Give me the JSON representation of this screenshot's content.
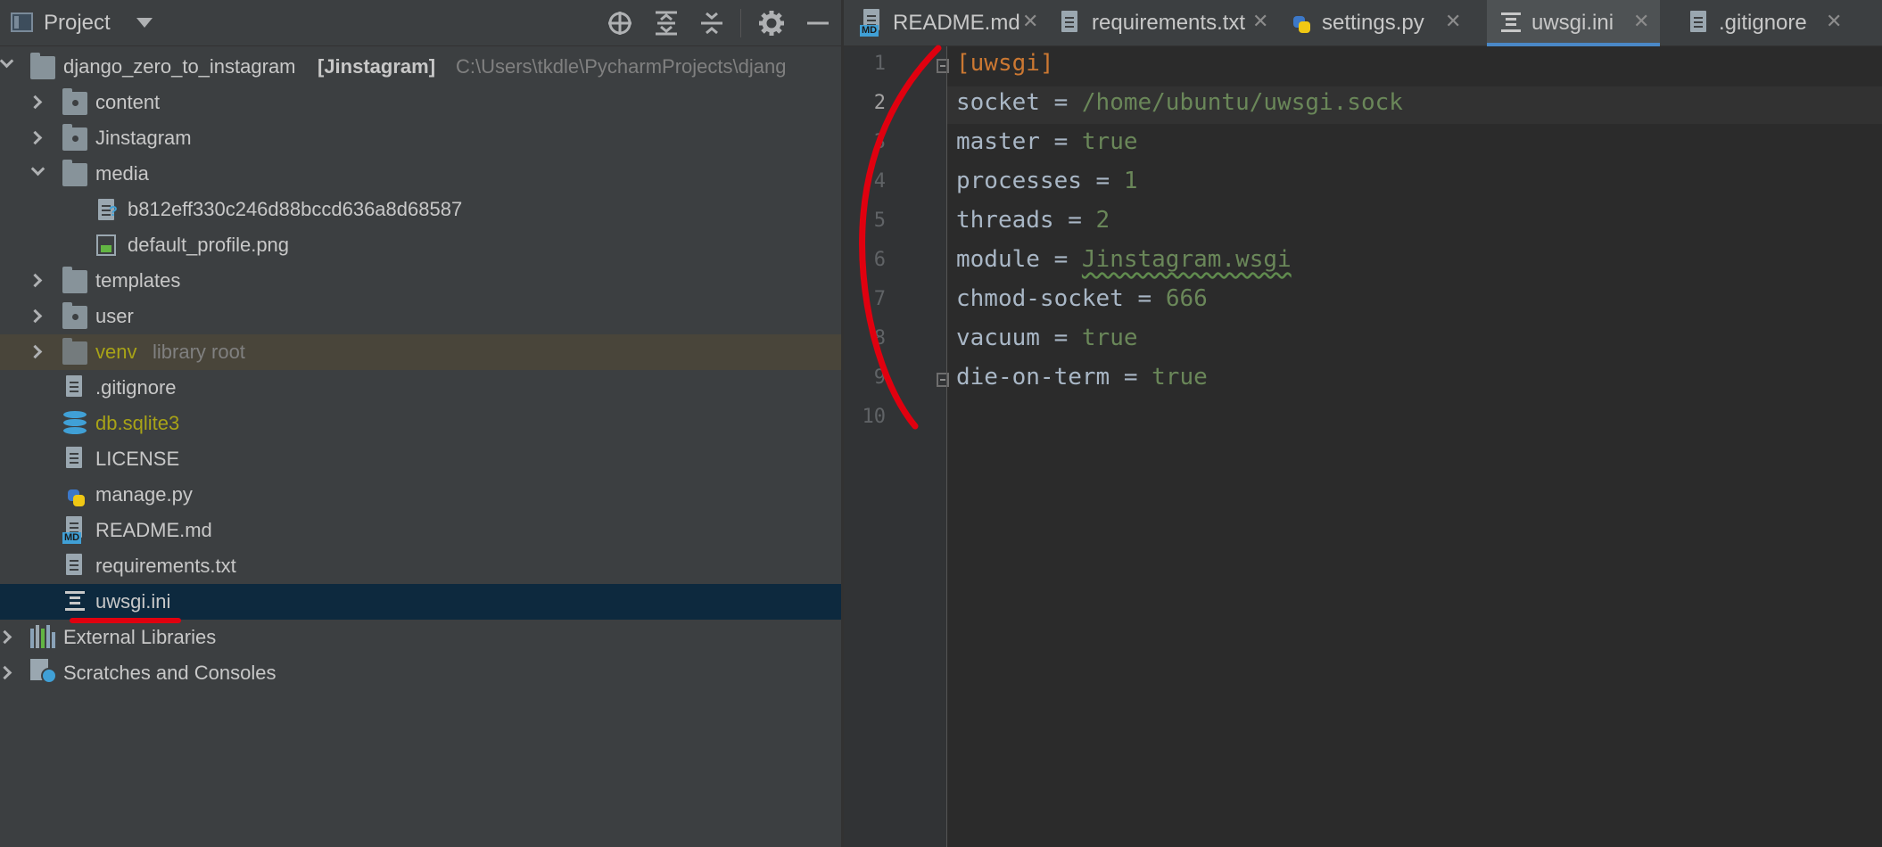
{
  "project_panel": {
    "title": "Project",
    "toolbar_icons": [
      "locate-icon",
      "expand-all-icon",
      "collapse-all-icon",
      "gear-icon",
      "minimize-icon"
    ],
    "root": {
      "name": "django_zero_to_instagram",
      "module": "[Jinstagram]",
      "path": "C:\\Users\\tkdle\\PycharmProjects\\djang"
    },
    "tree": [
      {
        "label": "content"
      },
      {
        "label": "Jinstagram"
      },
      {
        "label": "media"
      },
      {
        "label": "b812eff330c246d88bccd636a8d68587"
      },
      {
        "label": "default_profile.png"
      },
      {
        "label": "templates"
      },
      {
        "label": "user"
      },
      {
        "label": "venv",
        "hint": "library root"
      },
      {
        "label": ".gitignore"
      },
      {
        "label": "db.sqlite3"
      },
      {
        "label": "LICENSE"
      },
      {
        "label": "manage.py"
      },
      {
        "label": "README.md"
      },
      {
        "label": "requirements.txt"
      },
      {
        "label": "uwsgi.ini"
      },
      {
        "label": "External Libraries"
      },
      {
        "label": "Scratches and Consoles"
      }
    ]
  },
  "editor": {
    "tabs": [
      {
        "label": "README.md",
        "icon": "markdown-icon"
      },
      {
        "label": "requirements.txt",
        "icon": "text-file-icon"
      },
      {
        "label": "settings.py",
        "icon": "python-icon"
      },
      {
        "label": "uwsgi.ini",
        "icon": "ini-file-icon",
        "active": true
      },
      {
        "label": ".gitignore",
        "icon": "ignore-file-icon"
      }
    ],
    "line_numbers": [
      "1",
      "2",
      "3",
      "4",
      "5",
      "6",
      "7",
      "8",
      "9",
      "10"
    ],
    "current_line": 2,
    "lines": [
      {
        "section": "[uwsgi]"
      },
      {
        "key": "socket",
        "eq": " = ",
        "value": "/home/ubuntu/uwsgi.sock"
      },
      {
        "key": "master",
        "eq": " = ",
        "value": "true"
      },
      {
        "key": "processes",
        "eq": " = ",
        "value": "1"
      },
      {
        "key": "threads",
        "eq": " = ",
        "value": "2"
      },
      {
        "key": "module",
        "eq": " = ",
        "value": "Jinstagram.wsgi"
      },
      {
        "key": "chmod-socket",
        "eq": " = ",
        "value": "666"
      },
      {
        "key": "vacuum",
        "eq": " = ",
        "value": "true"
      },
      {
        "key": "die-on-term",
        "eq": " = ",
        "value": "true"
      }
    ]
  },
  "colors": {
    "annotation_red": "#e0000f",
    "selection": "#0d293e",
    "library_highlight": "#49453a",
    "section": "#cc7832",
    "value": "#6a8759"
  }
}
